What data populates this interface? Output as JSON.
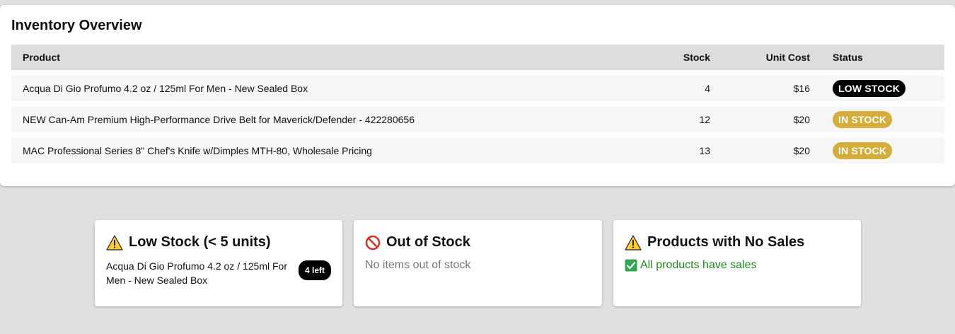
{
  "inventory": {
    "title": "Inventory Overview",
    "columns": {
      "product": "Product",
      "stock": "Stock",
      "unit_cost": "Unit Cost",
      "status": "Status"
    },
    "rows": [
      {
        "product": "Acqua Di Gio Profumo 4.2 oz / 125ml For Men - New Sealed Box",
        "stock": "4",
        "unit_cost": "$16",
        "status": "LOW STOCK"
      },
      {
        "product": "NEW Can-Am Premium High-Performance Drive Belt for Maverick/Defender - 422280656",
        "stock": "12",
        "unit_cost": "$20",
        "status": "IN STOCK"
      },
      {
        "product": "MAC Professional Series 8\" Chef's Knife w/Dimples MTH-80, Wholesale Pricing",
        "stock": "13",
        "unit_cost": "$20",
        "status": "IN STOCK"
      }
    ]
  },
  "alerts": {
    "low_stock": {
      "title": "Low Stock (< 5 units)",
      "icon": "warning-icon",
      "items": [
        {
          "name": "Acqua Di Gio Profumo 4.2 oz / 125ml For Men - New Sealed Box",
          "count": "4 left"
        }
      ]
    },
    "out_of_stock": {
      "title": "Out of Stock",
      "icon": "prohibited-icon",
      "message": "No items out of stock"
    },
    "no_sales": {
      "title": "Products with No Sales",
      "icon": "warning-icon",
      "message": "All products have sales",
      "message_icon": "checkmark-icon"
    }
  },
  "colors": {
    "page_bg": "#e0e0e0",
    "low_stock_badge": "#000000",
    "in_stock_badge": "#d4ad3a",
    "success_text": "#1a8a1a"
  }
}
